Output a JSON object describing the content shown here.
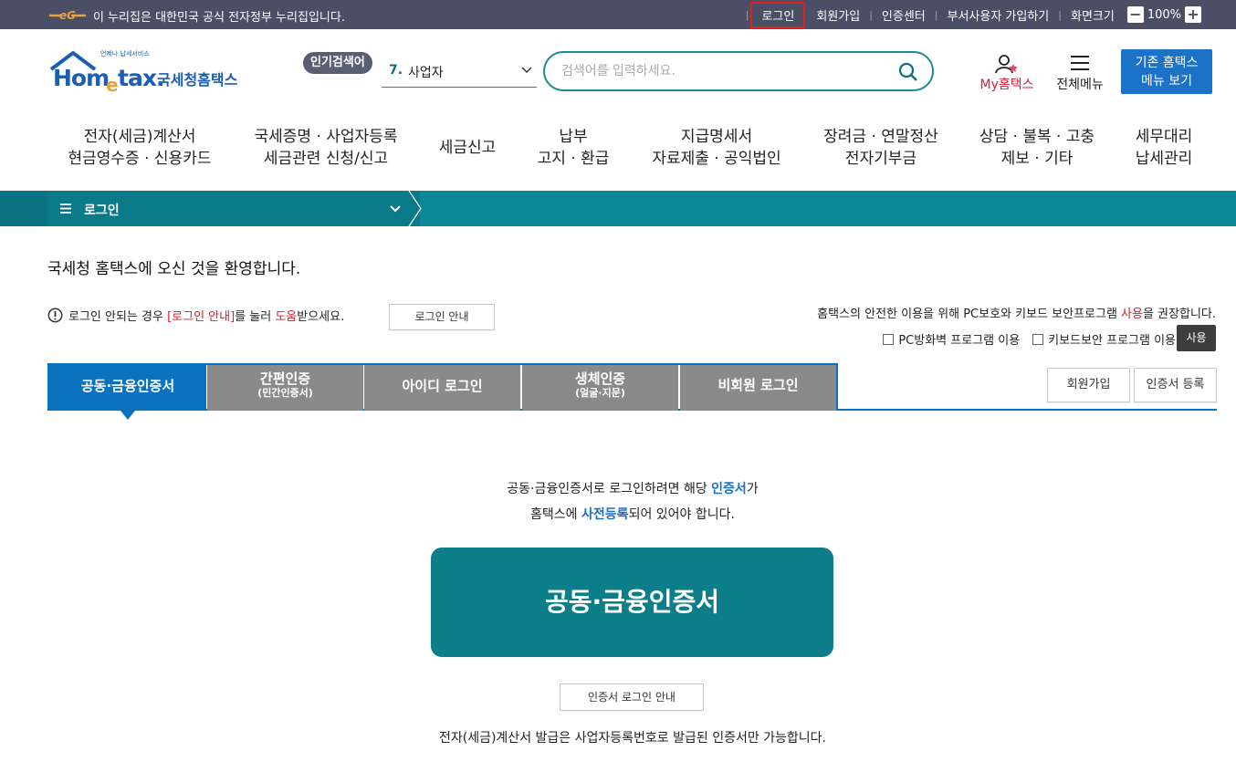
{
  "govbar": {
    "text": "이 누리집은 대한민국 공식 전자정부 누리집입니다.",
    "login": "로그인",
    "signup": "회원가입",
    "cert_center": "인증센터",
    "dept_signup": "부서사용자 가입하기",
    "screen_size": "화면크기",
    "zoom": "100%",
    "zoom_minus": "−",
    "zoom_plus": "+",
    "separator": "|"
  },
  "header": {
    "logo_small": "언제나 납세서비스",
    "logo_text": "국세청홈택스",
    "popular_label": "인기검색어",
    "popular_num": "7.",
    "popular_term": "사업자",
    "search_placeholder": "검색어를 입력하세요.",
    "my_label": "My홈택스",
    "allmenu_label": "전체메뉴",
    "old_home_line1": "기존 홈택스",
    "old_home_line2": "메뉴 보기"
  },
  "gnb": [
    {
      "l1": "전자(세금)계산서",
      "l2": "현금영수증 · 신용카드"
    },
    {
      "l1": "국세증명 · 사업자등록",
      "l2": "세금관련 신청/신고"
    },
    {
      "l1": "세금신고",
      "l2": ""
    },
    {
      "l1": "납부",
      "l2": "고지 · 환급"
    },
    {
      "l1": "지급명세서",
      "l2": "자료제출 · 공익법인"
    },
    {
      "l1": "장려금 · 연말정산",
      "l2": "전자기부금"
    },
    {
      "l1": "상담 · 불복 · 고충",
      "l2": "제보 · 기타"
    },
    {
      "l1": "세무대리",
      "l2": "납세관리"
    }
  ],
  "location": {
    "label": "로그인"
  },
  "main": {
    "welcome": "국세청 홈택스에 오신 것을 환영합니다.",
    "help_pre": "로그인 안되는 경우 ",
    "help_link": "[로그인 안내]",
    "help_mid": "를 눌러 ",
    "help_red": "도움",
    "help_post": "받으세요.",
    "help_button": "로그인 안내",
    "safe_pre": "홈택스의 안전한 이용을 위해 PC보호와 키보드 보안프로그램 ",
    "safe_red": "사용",
    "safe_post": "을 권장합니다.",
    "check_firewall": "PC방화벽 프로그램 이용",
    "check_keyboard": "키보드보안 프로그램 이용",
    "use_button": "사용"
  },
  "tabs": [
    {
      "label": "공동·금융인증서",
      "sub": ""
    },
    {
      "label": "간편인증",
      "sub": "(민간인증서)"
    },
    {
      "label": "아이디 로그인",
      "sub": ""
    },
    {
      "label": "생체인증",
      "sub": "(얼굴·지문)"
    },
    {
      "label": "비회원 로그인",
      "sub": ""
    }
  ],
  "side_buttons": {
    "signup": "회원가입",
    "cert_register": "인증서 등록"
  },
  "content": {
    "desc1_pre": "공동·금융인증서로 로그인하려면 해당 ",
    "desc1_blue": "인증서",
    "desc1_post": "가",
    "desc2_pre": "홈택스에 ",
    "desc2_blue": "사전등록",
    "desc2_post": "되어 있어야 합니다.",
    "big_button": "공동·금융인증서",
    "cert_guide_button": "인증서 로그인 안내",
    "note": "전자(세금)계산서 발급은 사업자등록번호로 발급된 인증서만 가능합니다."
  }
}
